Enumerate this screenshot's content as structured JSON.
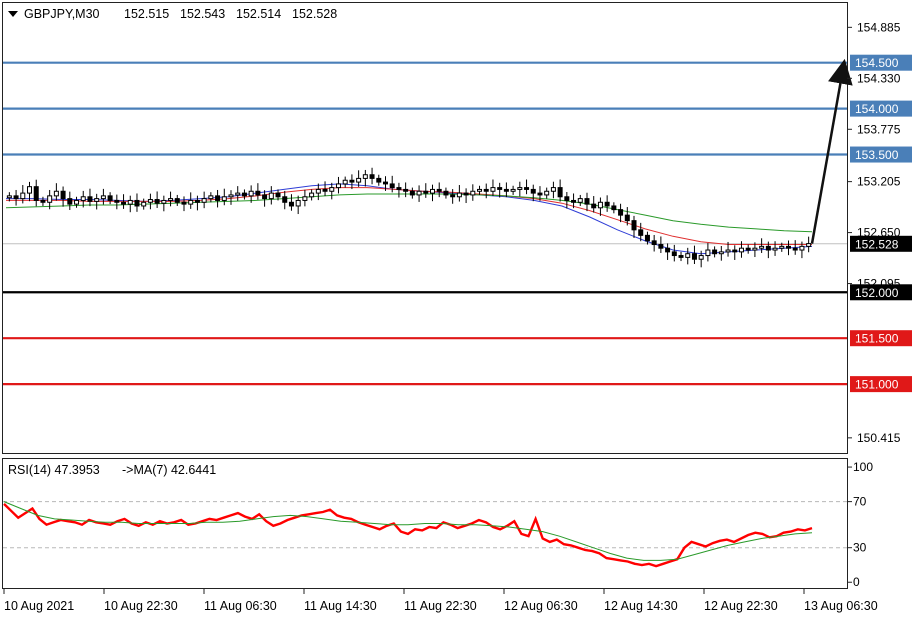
{
  "header": {
    "menu_arrow": "dropdown-triangle",
    "symbol": "GBPJPY,M30",
    "open": "152.515",
    "high": "152.543",
    "low": "152.514",
    "close": "152.528"
  },
  "rsi_header": {
    "label": "RSI(14) 47.3953",
    "ma_label": "->MA(7) 42.6441"
  },
  "colors": {
    "level_blue": "#4a7fb8",
    "level_red": "#e01818",
    "level_black": "#000000",
    "ma_blue": "#2f3dd6",
    "ma_red": "#e03030",
    "ma_green": "#2a9a2a",
    "rsi_line": "#ff0000",
    "rsi_ma": "#2a9a2a",
    "candle": "#000000",
    "grid_dash": "#b8b8b8"
  },
  "chart_data": [
    {
      "type": "candlestick",
      "title": "GBPJPY,M30",
      "ylim": [
        150.25,
        155.15
      ],
      "y_tick_labels": [
        "154.885",
        "154.330",
        "153.775",
        "153.205",
        "152.650",
        "152.095",
        "150.415"
      ],
      "x_tick_labels": [
        "10 Aug 2021",
        "10 Aug 22:30",
        "11 Aug 06:30",
        "11 Aug 14:30",
        "11 Aug 22:30",
        "12 Aug 06:30",
        "12 Aug 14:30",
        "12 Aug 22:30",
        "13 Aug 06:30"
      ],
      "close_series": [
        153.05,
        153.02,
        153.08,
        153.15,
        153.0,
        152.98,
        153.05,
        153.1,
        153.02,
        152.96,
        153.0,
        153.04,
        152.99,
        153.02,
        153.05,
        153.0,
        152.98,
        152.96,
        153.0,
        152.94,
        152.98,
        153.01,
        152.97,
        153.0,
        153.02,
        152.98,
        152.96,
        153.0,
        152.98,
        153.02,
        153.05,
        153.0,
        153.04,
        153.06,
        153.08,
        153.05,
        153.1,
        153.06,
        153.02,
        153.08,
        153.04,
        152.98,
        152.94,
        153.0,
        153.04,
        153.08,
        153.12,
        153.1,
        153.14,
        153.18,
        153.22,
        153.2,
        153.24,
        153.28,
        153.24,
        153.2,
        153.18,
        153.14,
        153.12,
        153.1,
        153.06,
        153.1,
        153.08,
        153.12,
        153.1,
        153.06,
        153.04,
        153.08,
        153.06,
        153.1,
        153.12,
        153.1,
        153.14,
        153.12,
        153.1,
        153.12,
        153.14,
        153.12,
        153.08,
        153.06,
        153.1,
        153.14,
        153.04,
        153.0,
        152.98,
        153.02,
        152.96,
        152.92,
        152.98,
        152.94,
        152.9,
        152.84,
        152.78,
        152.68,
        152.62,
        152.56,
        152.52,
        152.48,
        152.44,
        152.4,
        152.38,
        152.42,
        152.36,
        152.4,
        152.46,
        152.42,
        152.44,
        152.46,
        152.44,
        152.48,
        152.46,
        152.48,
        152.5,
        152.46,
        152.48,
        152.5,
        152.48,
        152.46,
        152.5,
        152.53
      ],
      "moving_averages": [
        {
          "color": "blue",
          "values": [
            153.02,
            153.02,
            153.01,
            153.01,
            153.0,
            152.99,
            153.0,
            153.02,
            153.04,
            153.08,
            153.12,
            153.16,
            153.18,
            153.16,
            153.12,
            153.1,
            153.08,
            153.06,
            153.04,
            153.0,
            152.94,
            152.82,
            152.68,
            152.56,
            152.46,
            152.42,
            152.44,
            152.46,
            152.48,
            152.5
          ]
        },
        {
          "color": "red",
          "values": [
            153.0,
            153.0,
            153.0,
            152.99,
            152.99,
            152.99,
            152.99,
            153.0,
            153.02,
            153.05,
            153.09,
            153.12,
            153.14,
            153.14,
            153.12,
            153.1,
            153.09,
            153.07,
            153.05,
            153.02,
            152.97,
            152.89,
            152.79,
            152.69,
            152.61,
            152.55,
            152.52,
            152.52,
            152.52,
            152.52
          ]
        },
        {
          "color": "green",
          "values": [
            152.92,
            152.93,
            152.94,
            152.95,
            152.95,
            152.96,
            152.97,
            152.98,
            152.99,
            153.0,
            153.02,
            153.04,
            153.06,
            153.07,
            153.07,
            153.07,
            153.07,
            153.06,
            153.05,
            153.03,
            153.0,
            152.96,
            152.9,
            152.84,
            152.78,
            152.74,
            152.71,
            152.69,
            152.67,
            152.66
          ]
        }
      ],
      "horizontal_levels": [
        {
          "value": 154.5,
          "label": "154.500",
          "color": "blue"
        },
        {
          "value": 154.0,
          "label": "154.000",
          "color": "blue"
        },
        {
          "value": 153.5,
          "label": "153.500",
          "color": "blue"
        },
        {
          "value": 152.0,
          "label": "152.000",
          "color": "black"
        },
        {
          "value": 151.5,
          "label": "151.500",
          "color": "red"
        },
        {
          "value": 151.0,
          "label": "151.000",
          "color": "red"
        }
      ],
      "current_price": {
        "value": 152.528,
        "label": "152.528"
      },
      "annotation_arrow": {
        "from": 152.53,
        "to": 154.5
      }
    },
    {
      "type": "line",
      "title": "RSI(14) 47.3953 ->MA(7) 42.6441",
      "ylim": [
        -5,
        107
      ],
      "y_tick_labels": [
        "100",
        "70",
        "30",
        "0"
      ],
      "reference_levels": [
        70,
        30
      ],
      "series": [
        {
          "color": "red",
          "values": [
            68,
            62,
            56,
            60,
            64,
            55,
            50,
            52,
            54,
            53,
            52,
            50,
            54,
            52,
            51,
            50,
            53,
            55,
            51,
            49,
            52,
            50,
            53,
            51,
            52,
            54,
            50,
            51,
            53,
            55,
            54,
            56,
            58,
            60,
            57,
            55,
            59,
            53,
            49,
            51,
            54,
            56,
            58,
            59,
            60,
            61,
            63,
            58,
            56,
            55,
            52,
            50,
            48,
            46,
            49,
            51,
            44,
            42,
            46,
            45,
            48,
            47,
            52,
            50,
            47,
            49,
            51,
            54,
            52,
            48,
            46,
            49,
            53,
            42,
            40,
            55,
            38,
            35,
            37,
            33,
            32,
            30,
            28,
            27,
            25,
            21,
            20,
            19,
            18,
            16,
            15,
            16,
            14,
            16,
            18,
            20,
            30,
            35,
            33,
            31,
            34,
            36,
            37,
            35,
            38,
            41,
            43,
            42,
            39,
            40,
            43,
            44,
            46,
            45,
            47
          ]
        },
        {
          "color": "green",
          "values": [
            70,
            64,
            58,
            55,
            54,
            53,
            52,
            52,
            51,
            51,
            51,
            51,
            52,
            52,
            53,
            55,
            57,
            58,
            57,
            55,
            53,
            52,
            51,
            50,
            50,
            51,
            51,
            50,
            50,
            49,
            48,
            46,
            44,
            40,
            35,
            30,
            25,
            21,
            19,
            19,
            20,
            24,
            28,
            32,
            35,
            38,
            40,
            42,
            43
          ]
        }
      ]
    }
  ]
}
